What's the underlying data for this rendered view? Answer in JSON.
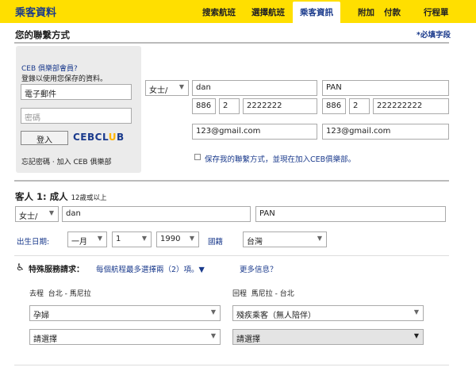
{
  "header": {
    "title": "乘客資料",
    "nav": [
      "搜索航班",
      "選擇航班",
      "乘客資訊",
      "附加",
      "付款",
      "行程單"
    ]
  },
  "contact": {
    "heading": "您的聯繫方式",
    "required_note": "*必填字段",
    "login": {
      "member_q": "CEB 俱樂部會員?",
      "hint": "登錄以使用您保存的資料。",
      "email_value": "電子郵件",
      "password_placeholder": "密碼",
      "login_button": "登入",
      "logo_a": "CEB",
      "logo_b": "CL",
      "logo_o": "U",
      "logo_c": "B",
      "footer": "忘記密碼 · 加入 CEB 俱樂部"
    },
    "title_select": "女士/",
    "first_name": "dan",
    "last_name": "PAN",
    "phone1": {
      "cc": "886",
      "area": "2",
      "num": "2222222"
    },
    "phone2": {
      "cc": "886",
      "area": "2",
      "num": "222222222"
    },
    "email1": "123@gmail.com",
    "email2": "123@gmail.com",
    "save_label": "保存我的聯繫方式，並現在加入CEB俱樂部。"
  },
  "passenger": {
    "heading_a": "客人 1: 成人",
    "heading_b": "12歲或以上",
    "title_select": "女士/",
    "first_name": "dan",
    "last_name": "PAN",
    "dob_label": "出生日期:",
    "month": "一月",
    "day": "1",
    "year": "1990",
    "nationality_label": "國籍",
    "nationality": "台灣"
  },
  "special": {
    "label": "特殊服務請求：",
    "per_flight": "每個航程最多選擇兩（2）項。▼",
    "more_info": "更多信息？",
    "outbound_label": "去程",
    "outbound_route": "台北 - 馬尼拉",
    "return_label": "回程",
    "return_route": "馬尼拉 - 台北",
    "outbound_sel1": "孕婦",
    "outbound_sel2": "請選擇",
    "return_sel1": "殘疾乘客（無人陪伴）",
    "return_sel2": "請選擇"
  }
}
